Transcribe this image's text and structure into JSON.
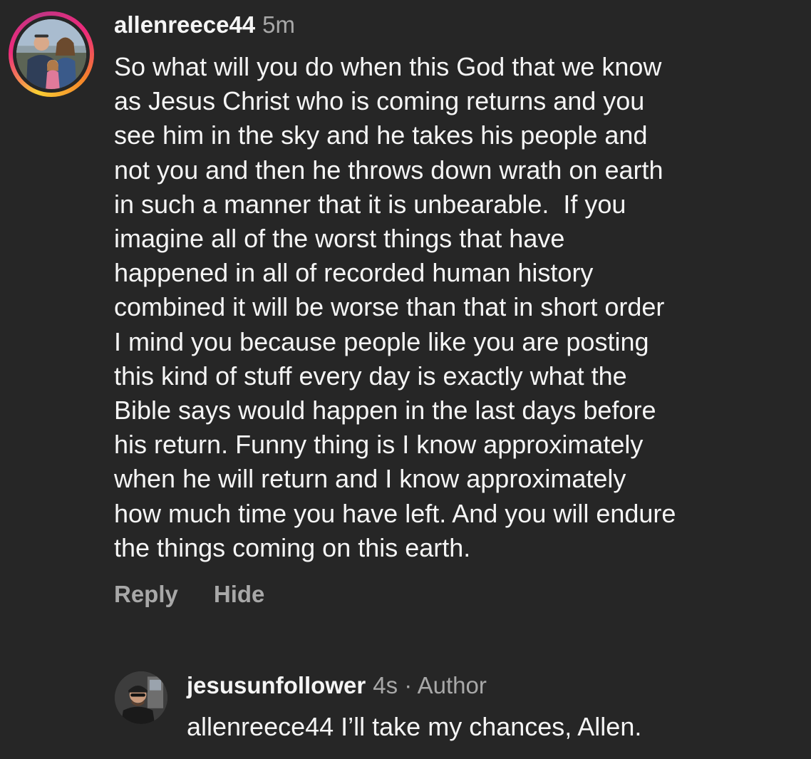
{
  "comment": {
    "username": "allenreece44",
    "time": "5m",
    "text": "So what will you do when this God that we know\nas Jesus Christ who is coming returns and you\nsee him in the sky and he takes his people and\nnot you and then he throws down wrath on earth\nin such a manner that it is unbearable.  If you\nimagine all of the worst things that have\nhappened in all of recorded human history\ncombined it will be worse than that in short order\nI mind you because people like you are posting\nthis kind of stuff every day is exactly what the\nBible says would happen in the last days before\nhis return. Funny thing is I know approximately\nwhen he will return and I know approximately\nhow much time you have left. And you will endure\nthe things coming on this earth.",
    "reply_label": "Reply",
    "hide_label": "Hide"
  },
  "reply": {
    "username": "jesusunfollower",
    "time": "4s",
    "separator": "·",
    "role": "Author",
    "text": "allenreece44 I’ll take my chances, Allen."
  },
  "colors": {
    "background": "#262626",
    "primary_text": "#f5f5f5",
    "secondary_text": "#a8a8a8",
    "story_ring_start": "#f9ce34",
    "story_ring_end": "#ee2a7b"
  }
}
